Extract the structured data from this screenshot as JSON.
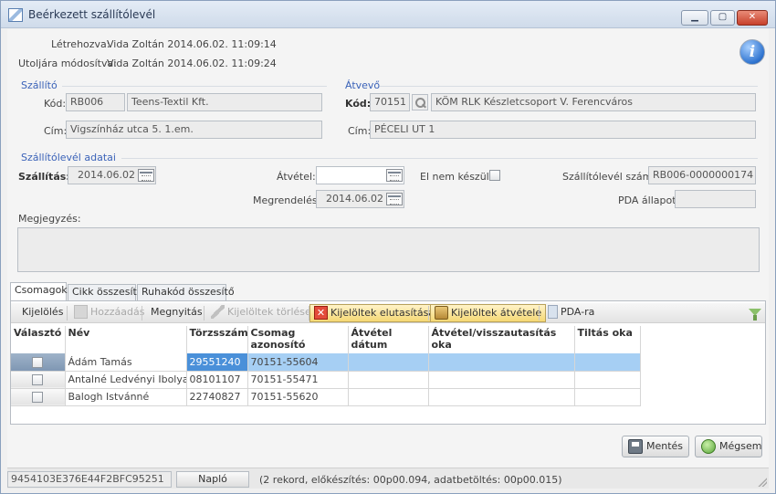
{
  "window": {
    "title": "Beérkezett szállítólevél",
    "minimize": "▁",
    "maximize": "▢",
    "close": "✕"
  },
  "meta": {
    "created_label": "Létrehozva:",
    "created_value": "Vida Zoltán 2014.06.02. 11:09:14",
    "modified_label": "Utoljára módosítva:",
    "modified_value": "Vida Zoltán 2014.06.02. 11:09:24"
  },
  "supplier": {
    "section": "Szállító",
    "code_label": "Kód:",
    "code": "RB006",
    "name": "Teens-Textil Kft.",
    "address_label": "Cím:",
    "address": "Vigszínház utca 5. 1.em."
  },
  "receiver": {
    "section": "Átvevő",
    "code_label": "Kód:",
    "code": "70151",
    "name": "KÖM RLK Készletcsoport V. Ferencváros",
    "address_label": "Cím:",
    "address": "PÉCELI UT 1"
  },
  "delivery": {
    "section": "Szállítólevél adatai",
    "shipping_label": "Szállítás:",
    "shipping_date": "2014.06.02",
    "receipt_label": "Átvétel:",
    "receipt_date": "",
    "not_prepared_label": "El nem készült:",
    "note_number_label": "Szállítólevél száma:",
    "note_number": "RB006-0000000174",
    "order_label": "Megrendelés:",
    "order_date": "2014.06.02",
    "pda_status_label": "PDA állapot:",
    "pda_status": "",
    "comment_label": "Megjegyzés:"
  },
  "tabs": [
    {
      "label": "Csomagok"
    },
    {
      "label": "Cikk összesítő"
    },
    {
      "label": "Ruhakód összesítő"
    }
  ],
  "toolbar": {
    "select": "Kijelölés",
    "add": "Hozzáadás",
    "view": "Megnyitás",
    "delete_selected": "Kijelöltek törlése",
    "reject_selected": "Kijelöltek elutasítása",
    "accept_selected": "Kijelöltek átvétele",
    "pda": "PDA-ra"
  },
  "grid": {
    "columns": [
      "Választó",
      "Név",
      "Törzsszám",
      "Csomag azonosító",
      "Átvétel dátum",
      "Átvétel/visszautasítás oka",
      "Tiltás oka"
    ],
    "rows": [
      {
        "name": "Ádám Tamás",
        "id": "29551240",
        "package": "70151-55604",
        "date": "",
        "reason": "",
        "block": ""
      },
      {
        "name": "Antalné Ledvényi Ibolya",
        "id": "08101107",
        "package": "70151-55471",
        "date": "",
        "reason": "",
        "block": ""
      },
      {
        "name": "Balogh Istvánné",
        "id": "22740827",
        "package": "70151-55620",
        "date": "",
        "reason": "",
        "block": ""
      }
    ]
  },
  "buttons": {
    "save": "Mentés",
    "cancel": "Mégsem"
  },
  "status": {
    "id": "9454103E376E44F2BFC95251",
    "log": "Napló",
    "info": "(2 rekord, előkészítés: 00p00.094, adatbetöltés: 00p00.015)"
  },
  "colors": {
    "accent": "#3a62b8",
    "selection": "#a6cff4",
    "selected_cell": "#4a90d9"
  }
}
